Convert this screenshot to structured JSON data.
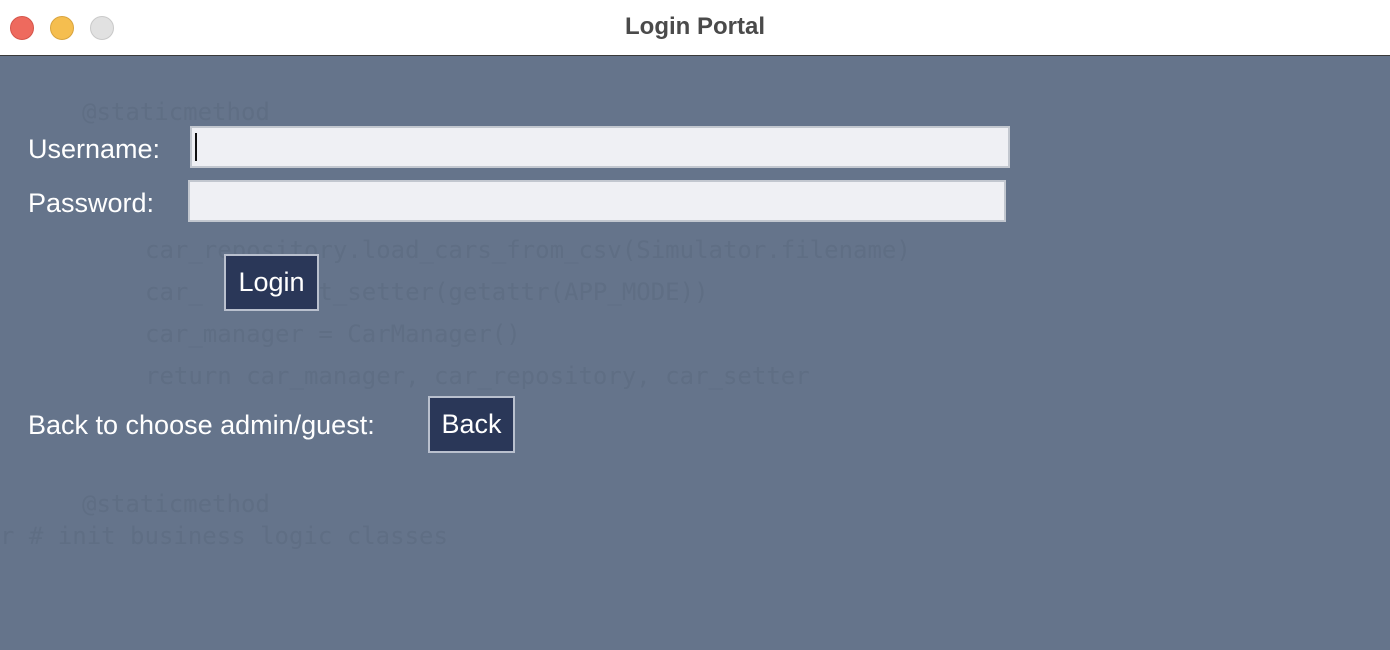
{
  "window": {
    "title": "Login Portal",
    "colors": {
      "background": "#65748b",
      "button": "#2a3758",
      "input": "#eff0f4"
    }
  },
  "form": {
    "username_label": "Username:",
    "username_value": "",
    "password_label": "Password:",
    "password_value": "",
    "login_label": "Login"
  },
  "back": {
    "prompt_label": "Back to choose admin/guest:",
    "button_label": "Back"
  }
}
